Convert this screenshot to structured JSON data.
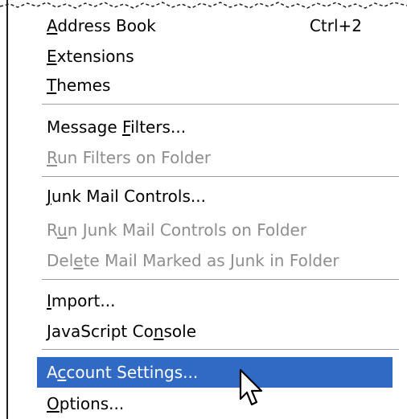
{
  "menu": {
    "items": [
      {
        "id": "address-book",
        "label": "Address Book",
        "access_key": "A",
        "shortcut": "Ctrl+2",
        "enabled": true
      },
      {
        "id": "extensions",
        "label": "Extensions",
        "access_key": "E",
        "enabled": true
      },
      {
        "id": "themes",
        "label": "Themes",
        "access_key": "T",
        "enabled": true
      },
      {
        "id": "message-filters",
        "label": "Message Filters...",
        "access_key": "F",
        "enabled": true
      },
      {
        "id": "run-filters-on-folder",
        "label": "Run Filters on Folder",
        "access_key": "R",
        "enabled": false
      },
      {
        "id": "junk-mail-controls",
        "label": "Junk Mail Controls...",
        "access_key": "J",
        "enabled": true
      },
      {
        "id": "run-junk-mail-controls-on-folder",
        "label": "Run Junk Mail Controls on Folder",
        "access_key": "u",
        "enabled": false
      },
      {
        "id": "delete-mail-marked-as-junk",
        "label": "Delete Mail Marked as Junk in Folder",
        "access_key": "e",
        "enabled": false
      },
      {
        "id": "import",
        "label": "Import...",
        "access_key": "I",
        "enabled": true
      },
      {
        "id": "javascript-console",
        "label": "JavaScript Console",
        "access_key": "n",
        "enabled": true
      },
      {
        "id": "account-settings",
        "label": "Account Settings...",
        "access_key": "c",
        "enabled": true,
        "highlighted": true
      },
      {
        "id": "options",
        "label": "Options...",
        "access_key": "O",
        "enabled": true
      }
    ]
  },
  "colors": {
    "highlight": "#316ac5",
    "disabled_text": "#8e8e8e",
    "separator": "#a0a0a0"
  },
  "cursor": {
    "icon": "mouse-pointer-icon"
  }
}
